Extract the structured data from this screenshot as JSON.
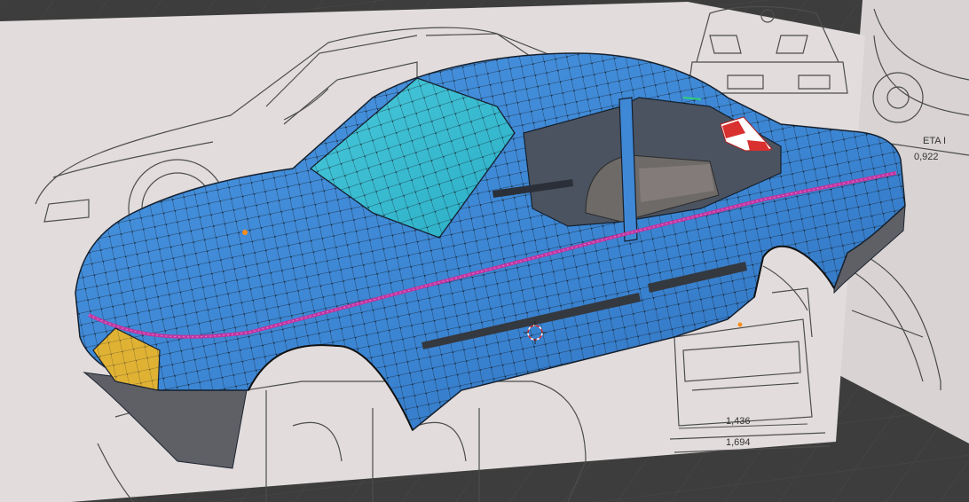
{
  "viewport": {
    "background_color": "#3d3d3d",
    "grid_color": "#4a4a4a",
    "x_axis_color": "#b54c4c",
    "y_axis_color": "#7aa83b"
  },
  "blueprint": {
    "sheet_color": "#e2dcdc",
    "line_color": "#4a4a4a",
    "labels": {
      "top_right_model": "ETA I",
      "width_upper": "0,922",
      "width_track": "1,436",
      "width_overall": "1,694"
    }
  },
  "mesh": {
    "body_color": "#3f88d6",
    "glass_color": "#35c0d6",
    "wire_color": "#1b2430",
    "vertex_color": "#111111",
    "seam_color": "#c0359f",
    "headlight_color": "#e0b233",
    "bumper_color": "#5f5f66",
    "active_vertex_color": "#ff8c1a"
  },
  "gizmos": {
    "cursor": "3d-cursor",
    "origin": "object-origin"
  }
}
